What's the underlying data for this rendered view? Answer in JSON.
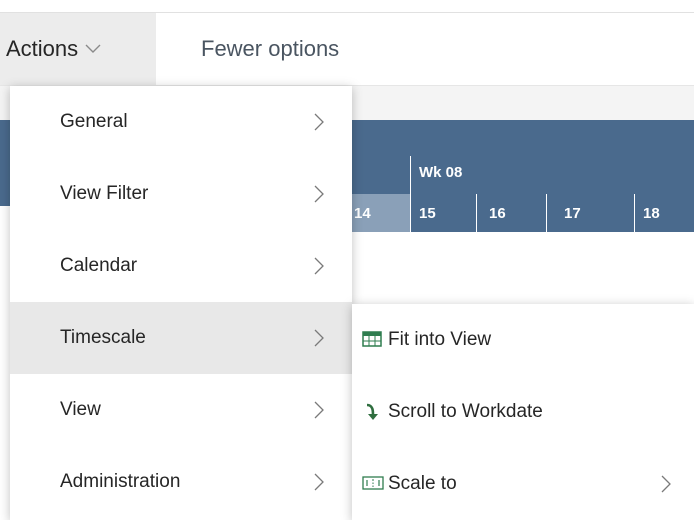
{
  "action_bar": {
    "actions_label": "Actions",
    "fewer_options_label": "Fewer options"
  },
  "gantt": {
    "week_label": "Wk 08",
    "prev_day": "14",
    "days": [
      "15",
      "16",
      "17",
      "18"
    ]
  },
  "menu": {
    "items": [
      {
        "label": "General"
      },
      {
        "label": "View Filter"
      },
      {
        "label": "Calendar"
      },
      {
        "label": "Timescale"
      },
      {
        "label": "View"
      },
      {
        "label": "Administration"
      }
    ]
  },
  "submenu": {
    "items": [
      {
        "label": "Fit into View",
        "icon": "fit-into-view-icon"
      },
      {
        "label": "Scroll to Workdate",
        "icon": "scroll-to-workdate-icon"
      },
      {
        "label": "Scale to",
        "icon": "scale-to-icon"
      }
    ]
  },
  "colors": {
    "gantt_header": "#4a6a8d",
    "gantt_prev_day": "#8aa0b8",
    "menu_active": "#e8e8e8",
    "actions_tab": "#ececec"
  }
}
